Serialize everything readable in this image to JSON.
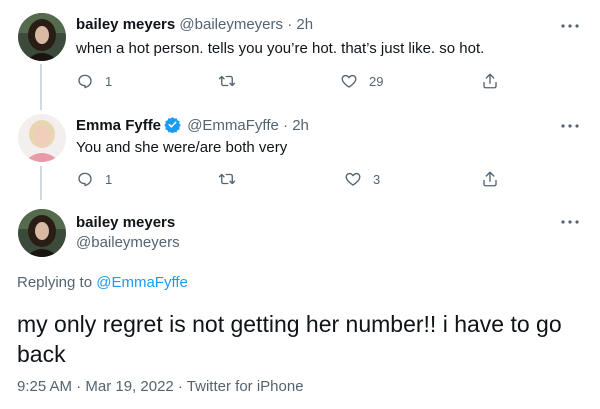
{
  "tweets": [
    {
      "name": "bailey meyers",
      "handle": "@baileymeyers",
      "separator": "·",
      "time": "2h",
      "text": "when a hot person. tells you you’re hot. that’s just like. so hot.",
      "reply_count": "1",
      "retweet_count": "",
      "like_count": "29"
    },
    {
      "name": "Emma Fyffe",
      "handle": "@EmmaFyffe",
      "separator": "·",
      "time": "2h",
      "text": "You and she were/are both very",
      "reply_count": "1",
      "retweet_count": "",
      "like_count": "3"
    }
  ],
  "focal": {
    "name": "bailey meyers",
    "handle": "@baileymeyers",
    "replying_prefix": "Replying to",
    "replying_to": "@EmmaFyffe",
    "text": "my only regret is not getting her number!! i have to go back",
    "meta": "9:25 AM · Mar 19, 2022 · Twitter for iPhone"
  },
  "icons": {
    "reply": "reply-icon",
    "retweet": "retweet-icon",
    "like": "heart-icon",
    "share": "share-icon",
    "more": "more-icon",
    "verified": "verified-badge-icon"
  },
  "colors": {
    "link": "#1d9bf0",
    "secondary_text": "#536471",
    "thread_line": "#cfd9de",
    "verified": "#1d9bf0"
  }
}
